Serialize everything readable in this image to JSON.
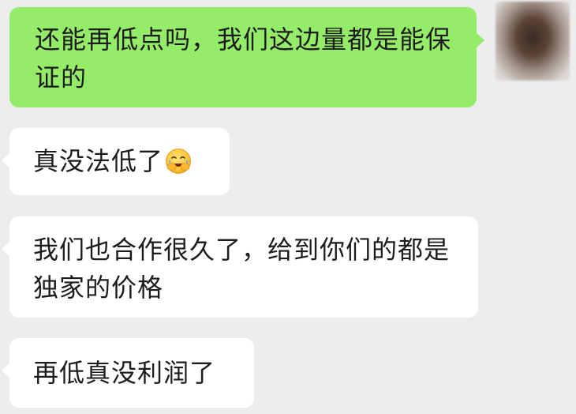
{
  "messages": [
    {
      "sender": "me",
      "text": "还能再低点吗，我们这边量都是能保证的"
    },
    {
      "sender": "other",
      "text": "真没法低了",
      "emoji": "face-palm-laugh-emoji"
    },
    {
      "sender": "other",
      "text": "我们也合作很久了，给到你们的都是独家的价格"
    },
    {
      "sender": "other",
      "text": "再低真没利润了"
    }
  ],
  "colors": {
    "background": "#ededed",
    "sent_bubble": "#95ec69",
    "received_bubble": "#ffffff",
    "text": "#1c1c1c"
  }
}
